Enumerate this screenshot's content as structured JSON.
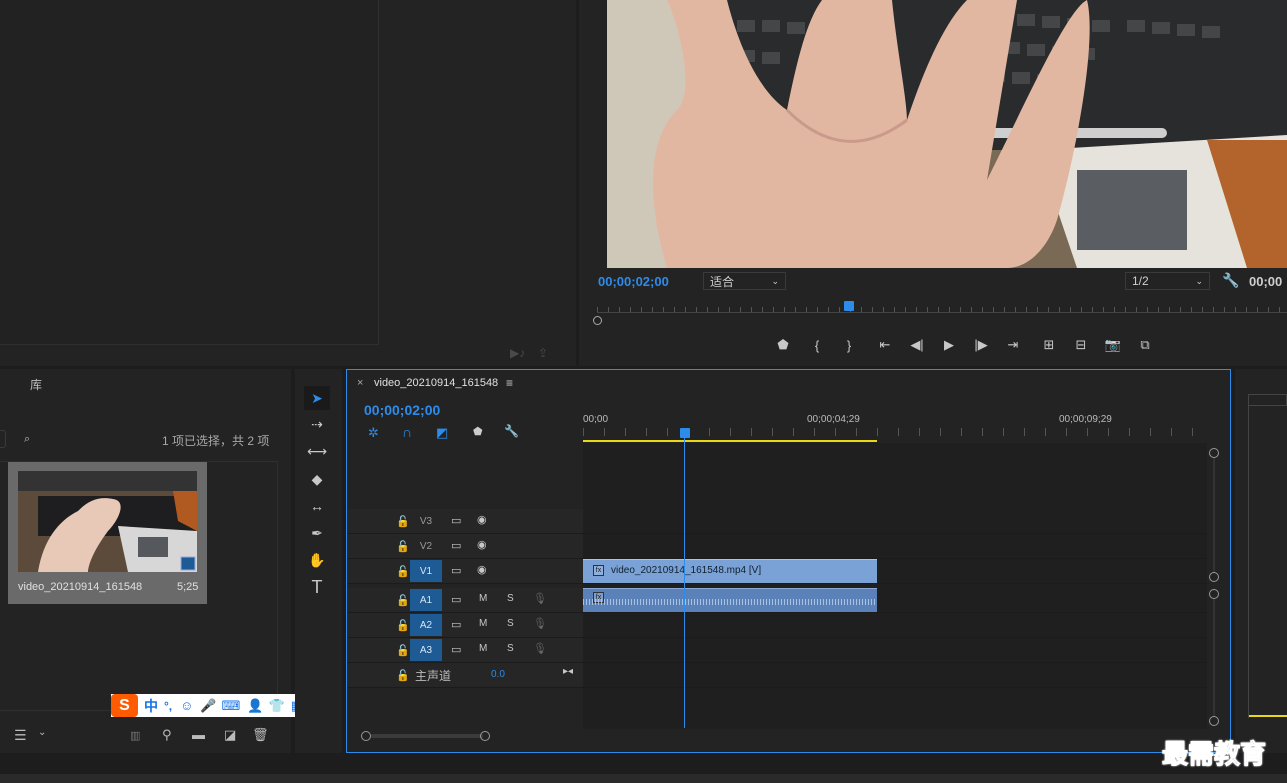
{
  "colors": {
    "accent": "#2d8ceb",
    "playhead_marker": "#2d8ceb",
    "work_area": "#e8d81a",
    "clip_video": "#7aa2d6",
    "clip_audio": "#5b82b8"
  },
  "program": {
    "timecode": "00;00;02;00",
    "fit_label": "适合",
    "resolution_label": "1/2",
    "duration_partial": "00;00",
    "playback_progress": 0.4
  },
  "project": {
    "tab_label": "库",
    "selection_info": "1 项已选择，共 2 项",
    "clip_name": "video_20210914_161548",
    "clip_duration": "5;25"
  },
  "timeline": {
    "sequence_name": "video_20210914_161548",
    "timecode": "00;00;02;00",
    "ruler": [
      "00;00",
      "00;00;04;29",
      "00;00;09;29"
    ],
    "video_tracks": [
      {
        "label": "V3",
        "active": false
      },
      {
        "label": "V2",
        "active": false
      },
      {
        "label": "V1",
        "active": true
      }
    ],
    "audio_tracks": [
      {
        "label": "A1",
        "active": true
      },
      {
        "label": "A2",
        "active": true
      },
      {
        "label": "A3",
        "active": true
      }
    ],
    "mute_label": "M",
    "solo_label": "S",
    "master_label": "主声道",
    "master_value": "0.0",
    "video_clip_label": "video_20210914_161548.mp4 [V]"
  },
  "ime": {
    "chinese_label": "中",
    "punct_label": "°,"
  },
  "watermark": "最需教育",
  "icons": [
    "lock-icon",
    "film-icon",
    "eye-icon",
    "mic-icon",
    "wrench-icon",
    "play-icon",
    "camera-icon",
    "selection-tool-icon",
    "hand-tool-icon",
    "type-tool-icon"
  ]
}
